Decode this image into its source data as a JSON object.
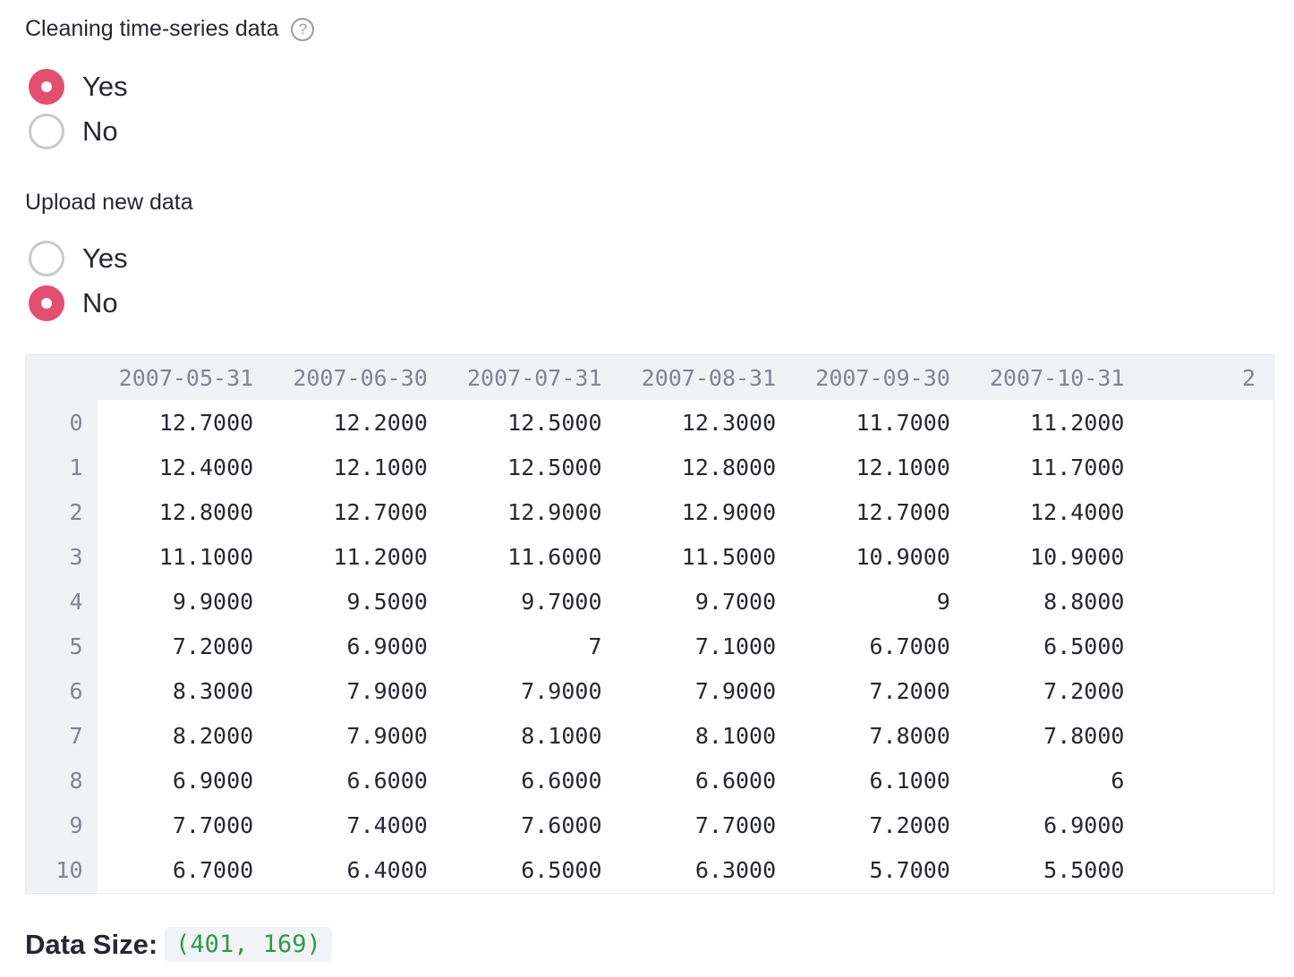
{
  "cleaning": {
    "label": "Cleaning time-series data",
    "help_glyph": "?",
    "options": [
      {
        "label": "Yes",
        "selected": true
      },
      {
        "label": "No",
        "selected": false
      }
    ]
  },
  "upload": {
    "label": "Upload new data",
    "options": [
      {
        "label": "Yes",
        "selected": false
      },
      {
        "label": "No",
        "selected": true
      }
    ]
  },
  "table": {
    "columns": [
      "2007-05-31",
      "2007-06-30",
      "2007-07-31",
      "2007-08-31",
      "2007-09-30",
      "2007-10-31",
      "2"
    ],
    "rows": [
      {
        "index": "0",
        "values": [
          "12.7000",
          "12.2000",
          "12.5000",
          "12.3000",
          "11.7000",
          "11.2000",
          ""
        ]
      },
      {
        "index": "1",
        "values": [
          "12.4000",
          "12.1000",
          "12.5000",
          "12.8000",
          "12.1000",
          "11.7000",
          ""
        ]
      },
      {
        "index": "2",
        "values": [
          "12.8000",
          "12.7000",
          "12.9000",
          "12.9000",
          "12.7000",
          "12.4000",
          ""
        ]
      },
      {
        "index": "3",
        "values": [
          "11.1000",
          "11.2000",
          "11.6000",
          "11.5000",
          "10.9000",
          "10.9000",
          ""
        ]
      },
      {
        "index": "4",
        "values": [
          "9.9000",
          "9.5000",
          "9.7000",
          "9.7000",
          "9",
          "8.8000",
          ""
        ]
      },
      {
        "index": "5",
        "values": [
          "7.2000",
          "6.9000",
          "7",
          "7.1000",
          "6.7000",
          "6.5000",
          ""
        ]
      },
      {
        "index": "6",
        "values": [
          "8.3000",
          "7.9000",
          "7.9000",
          "7.9000",
          "7.2000",
          "7.2000",
          ""
        ]
      },
      {
        "index": "7",
        "values": [
          "8.2000",
          "7.9000",
          "8.1000",
          "8.1000",
          "7.8000",
          "7.8000",
          ""
        ]
      },
      {
        "index": "8",
        "values": [
          "6.9000",
          "6.6000",
          "6.6000",
          "6.6000",
          "6.1000",
          "6",
          ""
        ]
      },
      {
        "index": "9",
        "values": [
          "7.7000",
          "7.4000",
          "7.6000",
          "7.7000",
          "7.2000",
          "6.9000",
          ""
        ]
      },
      {
        "index": "10",
        "values": [
          "6.7000",
          "6.4000",
          "6.5000",
          "6.3000",
          "5.7000",
          "5.5000",
          ""
        ]
      }
    ]
  },
  "data_size": {
    "label": "Data Size:",
    "value": "(401, 169)"
  },
  "colors": {
    "accent": "#e34f6f",
    "code_green": "#2e9a48",
    "header_bg": "#f0f2f6"
  }
}
